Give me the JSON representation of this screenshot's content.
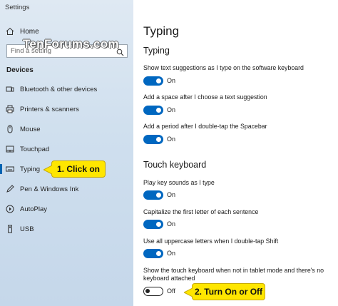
{
  "window": {
    "title": "Settings",
    "controls": [
      "minimize",
      "maximize",
      "close"
    ]
  },
  "watermark": "TenForums.com",
  "sidebar": {
    "home_label": "Home",
    "search_placeholder": "Find a setting",
    "section_heading": "Devices",
    "items": [
      {
        "label": "Bluetooth & other devices",
        "icon": "bluetooth-icon"
      },
      {
        "label": "Printers & scanners",
        "icon": "printer-icon"
      },
      {
        "label": "Mouse",
        "icon": "mouse-icon"
      },
      {
        "label": "Touchpad",
        "icon": "touchpad-icon"
      },
      {
        "label": "Typing",
        "icon": "keyboard-icon",
        "active": true
      },
      {
        "label": "Pen & Windows Ink",
        "icon": "pen-icon"
      },
      {
        "label": "AutoPlay",
        "icon": "autoplay-icon"
      },
      {
        "label": "USB",
        "icon": "usb-icon"
      }
    ]
  },
  "callouts": {
    "step1": "1. Click on",
    "step2": "2. Turn On or Off"
  },
  "main": {
    "page_title": "Typing",
    "groups": [
      {
        "heading": "Typing",
        "settings": [
          {
            "label": "Show text suggestions as I type on the software keyboard",
            "state": "On"
          },
          {
            "label": "Add a space after I choose a text suggestion",
            "state": "On"
          },
          {
            "label": "Add a period after I double-tap the Spacebar",
            "state": "On"
          }
        ]
      },
      {
        "heading": "Touch keyboard",
        "settings": [
          {
            "label": "Play key sounds as I type",
            "state": "On"
          },
          {
            "label": "Capitalize the first letter of each sentence",
            "state": "On"
          },
          {
            "label": "Use all uppercase letters when I double-tap Shift",
            "state": "On"
          },
          {
            "label": "Show the touch keyboard when not in tablet mode and there's no keyboard attached",
            "state": "Off"
          }
        ]
      }
    ]
  },
  "colors": {
    "accent": "#0067c0",
    "callout": "#ffe600"
  }
}
